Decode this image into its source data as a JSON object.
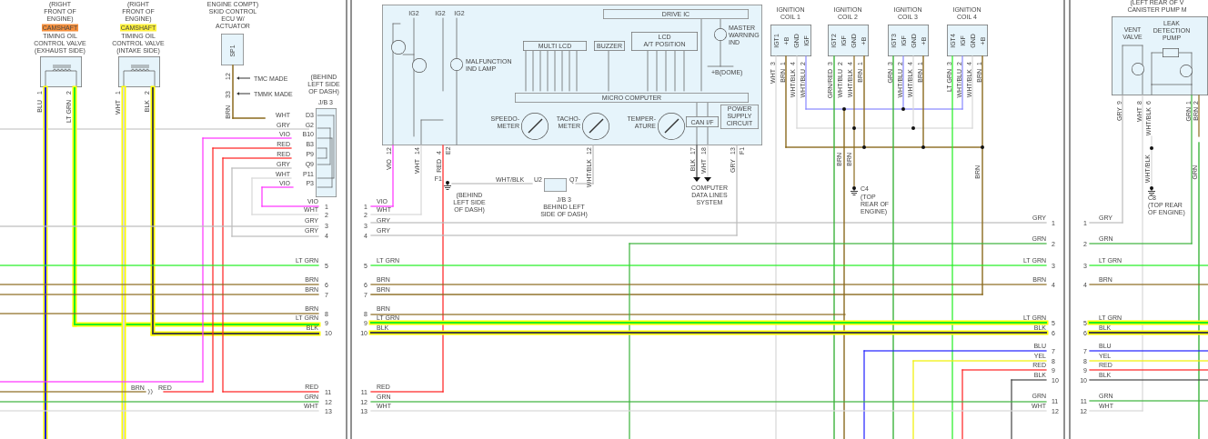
{
  "left_panel": {
    "valves": [
      {
        "location": [
          "(RIGHT",
          "FRONT OF",
          "ENGINE)"
        ],
        "tag": "CAMSHAFT",
        "color": "#f7903c",
        "name": [
          "TIMING OIL",
          "CONTROL VALVE",
          "(EXHAUST SIDE)"
        ],
        "pins": [
          {
            "number": "1",
            "wire": "BLU"
          },
          {
            "number": "2",
            "wire": "LT GRN"
          }
        ]
      },
      {
        "location": [
          "(RIGHT",
          "FRONT OF",
          "ENGINE)"
        ],
        "tag": "CAMSHAFT",
        "color": "#fff23a",
        "name": [
          "TIMING OIL",
          "CONTROL VALVE",
          "(INTAKE SIDE)"
        ],
        "pins": [
          {
            "number": "1",
            "wire": "WHT"
          },
          {
            "number": "2",
            "wire": "BLK"
          }
        ]
      }
    ],
    "skid_ecu": {
      "name": [
        "ENGINE COMPT)",
        "SKID CONTROL",
        "ECU W/",
        "ACTUATOR"
      ],
      "connector": "SP1",
      "pins": [
        {
          "number": "12",
          "note": "TMC MADE"
        },
        {
          "number": "33",
          "note": "TMMK MADE"
        }
      ],
      "wire": "BRN"
    },
    "junction_block": {
      "location": [
        "(BEHIND",
        "LEFT SIDE",
        "OF DASH)"
      ],
      "name": "J/B 3",
      "terminals": [
        {
          "wire": "WHT",
          "pin": "D3"
        },
        {
          "wire": "GRY",
          "pin": "G2"
        },
        {
          "wire": "VIO",
          "pin": "B10"
        },
        {
          "wire": "RED",
          "pin": "B3"
        },
        {
          "wire": "RED",
          "pin": "P9"
        },
        {
          "wire": "GRY",
          "pin": "Q9"
        },
        {
          "wire": "WHT",
          "pin": "P11"
        },
        {
          "wire": "VIO",
          "pin": "P3"
        }
      ]
    },
    "splice": [
      "BRN",
      "RED"
    ],
    "rows": [
      {
        "wire": "VIO",
        "number": "1"
      },
      {
        "wire": "WHT",
        "number": "2"
      },
      {
        "wire": "GRY",
        "number": "3"
      },
      {
        "wire": "GRY",
        "number": "4"
      },
      {
        "wire": "LT GRN",
        "number": "5"
      },
      {
        "wire": "BRN",
        "number": "6"
      },
      {
        "wire": "BRN",
        "number": "7"
      },
      {
        "wire": "BRN",
        "number": "8"
      },
      {
        "wire": "LT GRN",
        "number": "9"
      },
      {
        "wire": "BLK",
        "number": "10"
      },
      {
        "wire": "RED",
        "number": "11"
      },
      {
        "wire": "GRN",
        "number": "12"
      },
      {
        "wire": "WHT",
        "number": "13"
      }
    ]
  },
  "center_panel": {
    "rows": [
      {
        "wire": "VIO",
        "number": "1"
      },
      {
        "wire": "WHT",
        "number": "2"
      },
      {
        "wire": "GRY",
        "number": "3"
      },
      {
        "wire": "GRY",
        "number": "4"
      },
      {
        "wire": "LT GRN",
        "number": "5"
      },
      {
        "wire": "BRN",
        "number": "6"
      },
      {
        "wire": "BRN",
        "number": "7"
      },
      {
        "wire": "BRN",
        "number": "8"
      },
      {
        "wire": "LT GRN",
        "number": "9"
      },
      {
        "wire": "BLK",
        "number": "10"
      },
      {
        "wire": "RED",
        "number": "11"
      },
      {
        "wire": "GRN",
        "number": "12"
      },
      {
        "wire": "WHT",
        "number": "13"
      }
    ],
    "meter": {
      "supplies": [
        "IG2",
        "IG2",
        "IG2"
      ],
      "malfunction_lamp": [
        "MALFUNCTION",
        "IND LAMP"
      ],
      "drive_ic": "DRIVE IC",
      "master_warning": [
        "MASTER",
        "WARNING",
        "IND"
      ],
      "dome": "+B(DOME)",
      "blocks": [
        [
          "MULTI LCD"
        ],
        [
          "BUZZER"
        ],
        [
          "LCD",
          "A/T POSITION"
        ]
      ],
      "micro_computer": "MICRO COMPUTER",
      "gauges": [
        [
          "SPEEDO-",
          "METER"
        ],
        [
          "TACHO-",
          "METER"
        ],
        [
          "TEMPER-",
          "ATURE"
        ]
      ],
      "can_if": "CAN I/F",
      "power_supply": [
        "POWER",
        "SUPPLY",
        "CIRCUIT"
      ],
      "pins": [
        {
          "number": "12",
          "wire": "VIO"
        },
        {
          "number": "14",
          "wire": "WHT"
        },
        {
          "number": "4",
          "wire": "RED",
          "connector": "E2"
        },
        {
          "number": "12",
          "wire": "WHT/BLK"
        },
        {
          "number": "17",
          "wire": "BLK"
        },
        {
          "number": "18",
          "wire": "WHT"
        },
        {
          "number": "13",
          "wire": "GRY",
          "connector": "F1"
        }
      ]
    },
    "ground": {
      "name": "F1",
      "location": [
        "(BEHIND",
        "LEFT SIDE",
        "OF DASH)"
      ]
    },
    "jb": {
      "wire": "WHT/BLK",
      "pins": [
        "U2",
        "Q7"
      ],
      "name": [
        "J/B 3",
        "BEHIND LEFT",
        "SIDE OF DASH)"
      ]
    },
    "data_lines": [
      "COMPUTER",
      "DATA LINES",
      "SYSTEM"
    ],
    "coils": [
      {
        "name": [
          "IGNITION",
          "COIL 1"
        ],
        "pins": [
          {
            "label": "IGT1",
            "number": "3",
            "wire": "WHT"
          },
          {
            "label": "+B",
            "number": "1",
            "wire": "BRN"
          },
          {
            "label": "GND",
            "number": "4",
            "wire": "WHT/BLK"
          },
          {
            "label": "IGF",
            "number": "2",
            "wire": "WHT/BLU"
          }
        ]
      },
      {
        "name": [
          "IGNITION",
          "COIL 2"
        ],
        "pins": [
          {
            "label": "IGT2",
            "number": "3",
            "wire": "GRN/RED"
          },
          {
            "label": "IGF",
            "number": "2",
            "wire": "WHT/BLU"
          },
          {
            "label": "GND",
            "number": "4",
            "wire": "WHT/BLK"
          },
          {
            "label": "+B",
            "number": "1",
            "wire": "BRN"
          }
        ]
      },
      {
        "name": [
          "IGNITION",
          "COIL 3"
        ],
        "pins": [
          {
            "label": "IGT3",
            "number": "3",
            "wire": "GRN"
          },
          {
            "label": "IGF",
            "number": "2",
            "wire": "WHT/BLU"
          },
          {
            "label": "GND",
            "number": "4",
            "wire": "WHT/BLK"
          },
          {
            "label": "+B",
            "number": "1",
            "wire": "BRN"
          }
        ]
      },
      {
        "name": [
          "IGNITION",
          "COIL 4"
        ],
        "pins": [
          {
            "label": "IGT4",
            "number": "3",
            "wire": "LT GRN"
          },
          {
            "label": "IGF",
            "number": "2",
            "wire": "WHT/BLU"
          },
          {
            "label": "GND",
            "number": "4",
            "wire": "WHT/BLK"
          },
          {
            "label": "+B",
            "number": "1",
            "wire": "BRN"
          }
        ]
      }
    ],
    "coil_wire_labels": [
      "BRN",
      "BRN",
      "BRN"
    ],
    "coil_ground": {
      "name": "C4",
      "location": [
        "(TOP",
        "REAR OF",
        "ENGINE)"
      ]
    },
    "right_rows": [
      {
        "wire": "GRY",
        "number": "1"
      },
      {
        "wire": "GRN",
        "number": "2"
      },
      {
        "wire": "LT GRN",
        "number": "3"
      },
      {
        "wire": "BRN",
        "number": "4"
      },
      {
        "wire": "LT GRN",
        "number": "5"
      },
      {
        "wire": "BLK",
        "number": "6"
      },
      {
        "wire": "BLU",
        "number": "7"
      },
      {
        "wire": "YEL",
        "number": "8"
      },
      {
        "wire": "RED",
        "number": "9"
      },
      {
        "wire": "BLK",
        "number": "10"
      },
      {
        "wire": "GRN",
        "number": "11"
      },
      {
        "wire": "WHT",
        "number": "12"
      }
    ]
  },
  "right_panel": {
    "header": [
      "(LEFT REAR OF V",
      "CANISTER PUMP M"
    ],
    "vent_valve": [
      "VENT",
      "VALVE"
    ],
    "pump": [
      "LEAK",
      "DETECTION",
      "PUMP"
    ],
    "pins": [
      {
        "number": "9",
        "wire": "GRY"
      },
      {
        "number": "8",
        "wire": "WHT"
      },
      {
        "number": "6",
        "wire": "WHT/BLK"
      },
      {
        "number": "1",
        "wire": "GRN"
      },
      {
        "number": "2",
        "wire": "BRN"
      }
    ],
    "wire_labels": [
      "WHT/BLK",
      "GRN"
    ],
    "ground": {
      "name": "C8",
      "location": [
        "(TOP REAR",
        "OF ENGINE)"
      ]
    },
    "rows": [
      {
        "wire": "GRY",
        "number": "1"
      },
      {
        "wire": "GRN",
        "number": "2"
      },
      {
        "wire": "LT GRN",
        "number": "3"
      },
      {
        "wire": "BRN",
        "number": "4"
      },
      {
        "wire": "LT GRN",
        "number": "5"
      },
      {
        "wire": "BLK",
        "number": "6"
      },
      {
        "wire": "BLU",
        "number": "7"
      },
      {
        "wire": "YEL",
        "number": "8"
      },
      {
        "wire": "RED",
        "number": "9"
      },
      {
        "wire": "BLK",
        "number": "10"
      },
      {
        "wire": "GRN",
        "number": "11"
      },
      {
        "wire": "WHT",
        "number": "12"
      }
    ]
  }
}
